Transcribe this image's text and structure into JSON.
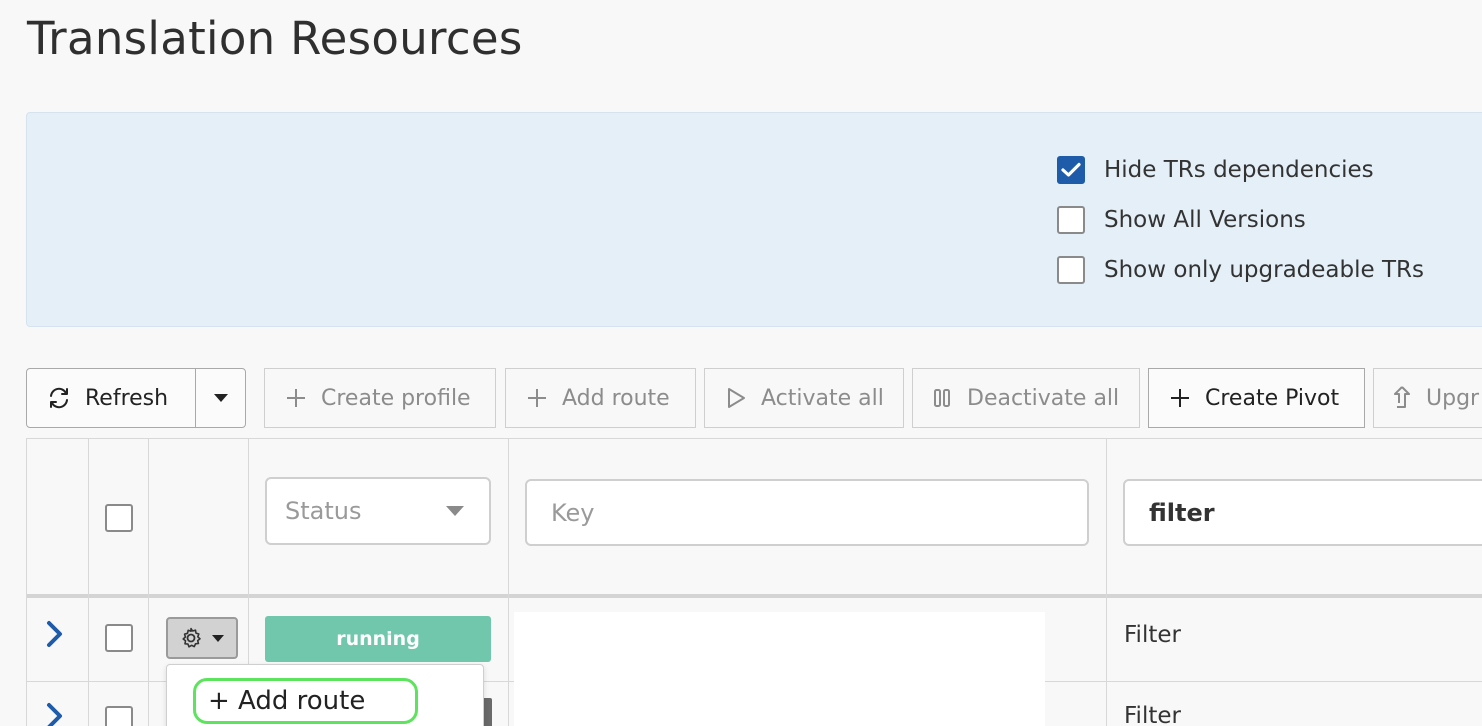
{
  "page": {
    "title": "Translation Resources"
  },
  "options": {
    "hide_dependencies": {
      "label": "Hide TRs dependencies",
      "checked": true
    },
    "show_all_versions": {
      "label": "Show All Versions",
      "checked": false
    },
    "show_upgradeable": {
      "label": "Show only upgradeable TRs",
      "checked": false
    }
  },
  "toolbar": {
    "refresh_label": "Refresh",
    "create_profile_label": "Create profile",
    "add_route_label": "Add route",
    "activate_all_label": "Activate all",
    "deactivate_all_label": "Deactivate all",
    "create_pivot_label": "Create Pivot",
    "upgrade_label": "Upgr"
  },
  "table": {
    "filters": {
      "status_placeholder": "Status",
      "key_placeholder": "Key",
      "filter_value": "filter"
    },
    "rows": [
      {
        "status": "running",
        "type": "Filter"
      },
      {
        "status": "",
        "type": "Filter"
      }
    ]
  },
  "row_menu": {
    "add_route_label": "+ Add route"
  },
  "colors": {
    "accent": "#1e5ba8",
    "running": "#71c7ab",
    "highlight": "#5ee35e",
    "panel": "#e4eff7"
  }
}
